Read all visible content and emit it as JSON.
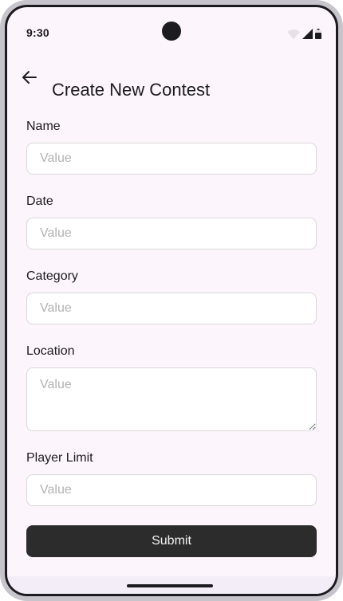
{
  "status_bar": {
    "time": "9:30",
    "icons": [
      "wifi-icon",
      "signal-icon",
      "battery-icon"
    ]
  },
  "header": {
    "back_icon": "arrow-left-icon",
    "title": "Create New Contest"
  },
  "form": {
    "fields": [
      {
        "label": "Name",
        "placeholder": "Value",
        "value": ""
      },
      {
        "label": "Date",
        "placeholder": "Value",
        "value": ""
      },
      {
        "label": "Category",
        "placeholder": "Value",
        "value": ""
      },
      {
        "label": "Location",
        "placeholder": "Value",
        "value": "",
        "multiline": true
      },
      {
        "label": "Player Limit",
        "placeholder": "Value",
        "value": ""
      }
    ],
    "submit_label": "Submit"
  },
  "colors": {
    "background": "#fdf5fc",
    "button": "#2c2c2c",
    "button_text": "#f5f5f5",
    "text": "#1c1b1f",
    "placeholder": "#b3b3b3",
    "border": "#d9d9d9"
  }
}
